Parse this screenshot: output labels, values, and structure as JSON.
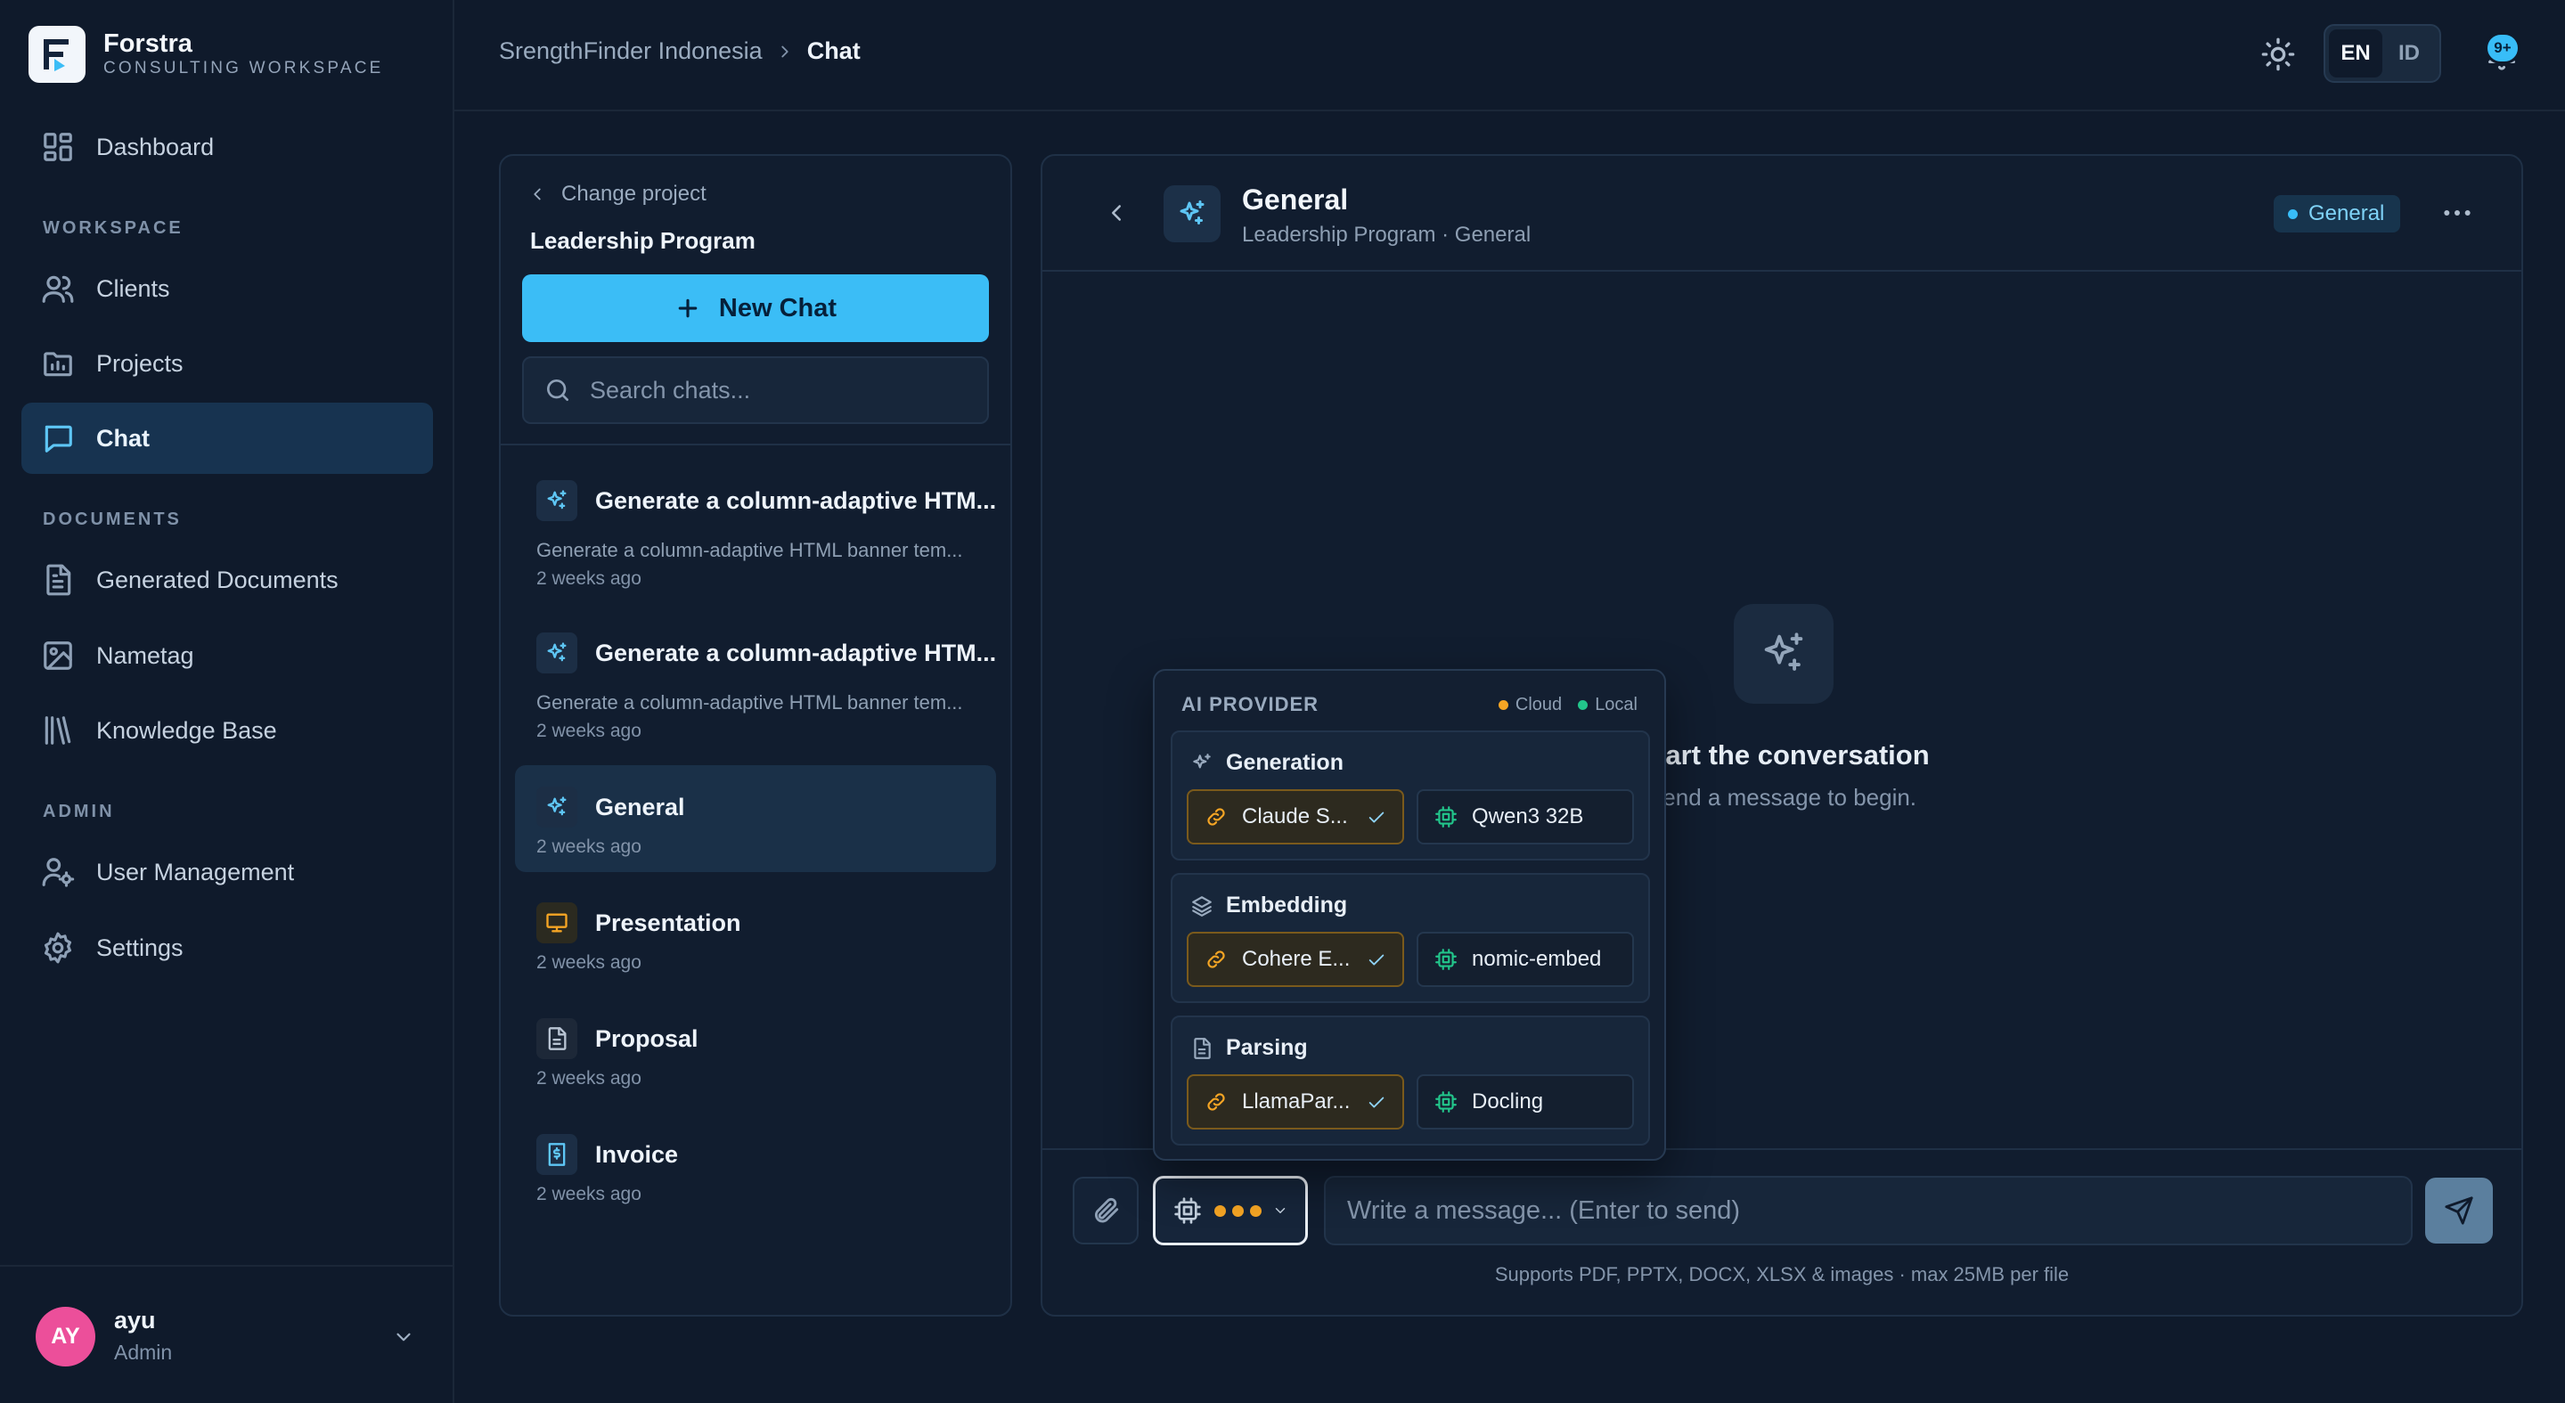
{
  "brand": {
    "name": "Forstra",
    "subtitle": "CONSULTING WORKSPACE"
  },
  "nav": {
    "dashboard": "Dashboard",
    "workspace_label": "WORKSPACE",
    "clients": "Clients",
    "projects": "Projects",
    "chat": "Chat",
    "documents_label": "DOCUMENTS",
    "generated_documents": "Generated Documents",
    "nametag": "Nametag",
    "knowledge_base": "Knowledge Base",
    "admin_label": "ADMIN",
    "user_management": "User Management",
    "settings": "Settings"
  },
  "user": {
    "initials": "AY",
    "name": "ayu",
    "role": "Admin"
  },
  "topbar": {
    "breadcrumb_root": "SrengthFinder Indonesia",
    "breadcrumb_current": "Chat",
    "lang_en": "EN",
    "lang_id": "ID",
    "notification_badge": "9+"
  },
  "chat_list": {
    "change_project": "Change project",
    "project_title": "Leadership Program",
    "new_chat": "New Chat",
    "search_placeholder": "Search chats...",
    "items": [
      {
        "title": "Generate a column-adaptive HTM...",
        "preview": "Generate a column-adaptive HTML banner tem...",
        "time": "2 weeks ago",
        "icon": "sparkles-icon"
      },
      {
        "title": "Generate a column-adaptive HTM...",
        "preview": "Generate a column-adaptive HTML banner tem...",
        "time": "2 weeks ago",
        "icon": "sparkles-icon"
      },
      {
        "title": "General",
        "time": "2 weeks ago",
        "icon": "sparkles-icon",
        "active": true
      },
      {
        "title": "Presentation",
        "time": "2 weeks ago",
        "icon": "presentation-icon"
      },
      {
        "title": "Proposal",
        "time": "2 weeks ago",
        "icon": "document-icon"
      },
      {
        "title": "Invoice",
        "time": "2 weeks ago",
        "icon": "invoice-icon"
      }
    ]
  },
  "conversation": {
    "title": "General",
    "subtitle": "Leadership Program · General",
    "badge": "General",
    "empty_title": "Start the conversation",
    "empty_subtitle": "Send a message to begin.",
    "message_placeholder": "Write a message... (Enter to send)",
    "hint": "Supports PDF, PPTX, DOCX, XLSX & images · max 25MB per file"
  },
  "ai_provider": {
    "heading": "AI PROVIDER",
    "legend_cloud": "Cloud",
    "legend_local": "Local",
    "groups": [
      {
        "name": "Generation",
        "cloud": "Claude S...",
        "local": "Qwen3 32B"
      },
      {
        "name": "Embedding",
        "cloud": "Cohere E...",
        "local": "nomic-embed"
      },
      {
        "name": "Parsing",
        "cloud": "LlamaPar...",
        "local": "Docling"
      }
    ]
  },
  "colors": {
    "accent": "#3bbdf6",
    "cloud": "#f5a524",
    "local": "#22c58b",
    "avatar": "#ec4f9a"
  }
}
